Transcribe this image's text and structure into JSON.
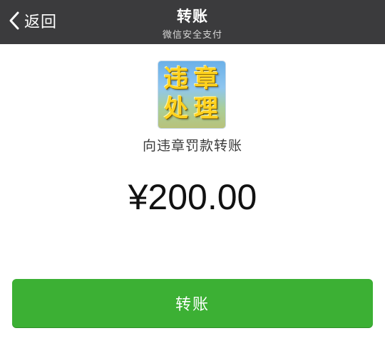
{
  "navbar": {
    "back_label": "返回",
    "title": "转账",
    "subtitle": "微信安全支付"
  },
  "payee": {
    "logo_chars": [
      "违",
      "章",
      "处",
      "理"
    ],
    "name": "向违章罚款转账"
  },
  "amount": "¥200.00",
  "button": {
    "label": "转账"
  },
  "colors": {
    "navbar_bg": "#3b3b3d",
    "button_green": "#3cb034",
    "logo_text": "#ffd21e"
  },
  "icons": {
    "back": "chevron-left-icon"
  }
}
